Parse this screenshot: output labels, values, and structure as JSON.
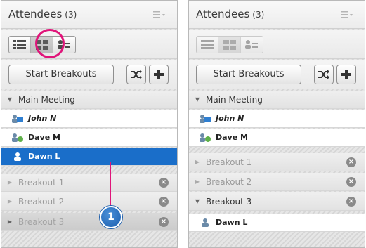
{
  "left_panel": {
    "title": "Attendees",
    "count": "(3)",
    "start_breakouts_label": "Start Breakouts",
    "main_meeting_label": "Main Meeting",
    "users": [
      "John N",
      "Dave M",
      "Dawn L"
    ],
    "breakouts": [
      "Breakout 1",
      "Breakout 2",
      "Breakout 3"
    ]
  },
  "right_panel": {
    "title": "Attendees",
    "count": "(3)",
    "start_breakouts_label": "Start Breakouts",
    "main_meeting_label": "Main Meeting",
    "main_users": [
      "John N",
      "Dave M"
    ],
    "breakouts": [
      "Breakout 1",
      "Breakout 2",
      "Breakout 3"
    ],
    "breakout3_user": "Dawn L"
  },
  "callout": {
    "number": "1"
  },
  "colors": {
    "selection": "#1a6ec9",
    "highlight": "#e0157a",
    "callout": "#1c5fae"
  }
}
